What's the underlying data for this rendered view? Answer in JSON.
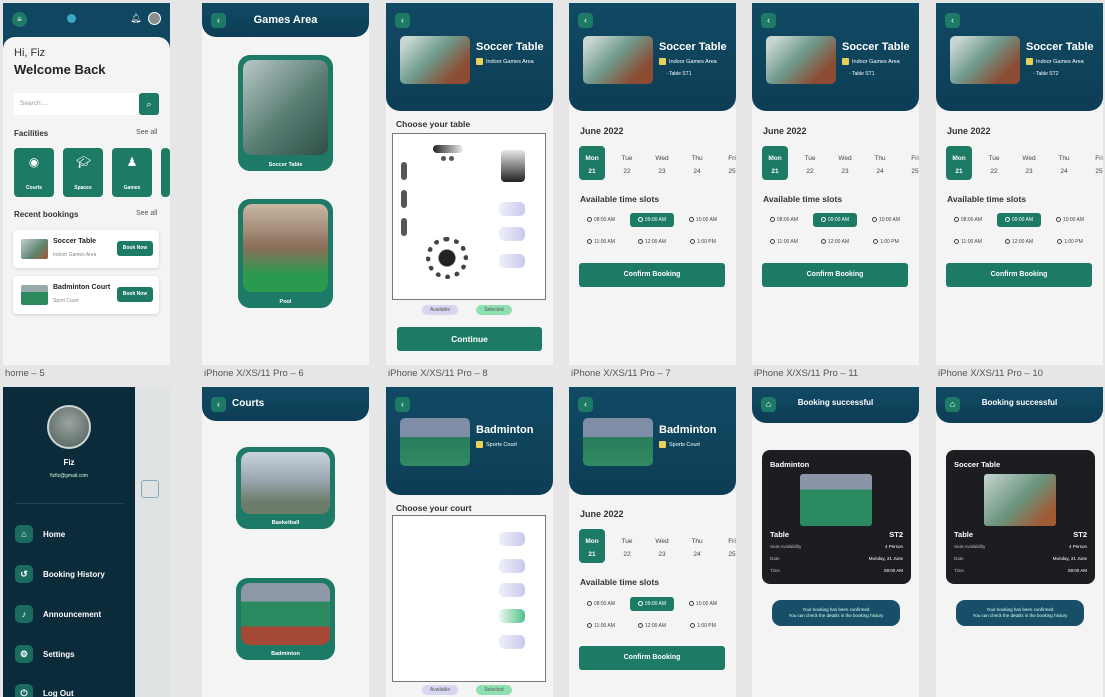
{
  "labels": {
    "home": "home – 5",
    "games": "iPhone X/XS/11 Pro – 6",
    "choose_table": "iPhone X/XS/11 Pro – 8",
    "date_7": "iPhone X/XS/11 Pro – 7",
    "date_11": "iPhone X/XS/11 Pro – 11",
    "date_10": "iPhone X/XS/11 Pro – 10"
  },
  "home": {
    "greeting": "Hi, Fiz",
    "welcome": "Welcome Back",
    "search_placeholder": "Search....",
    "facilities_title": "Facilities",
    "see_all": "See all",
    "facilities": [
      "Courts",
      "Spaces",
      "Games"
    ],
    "recent_title": "Recent bookings",
    "recent": [
      {
        "name": "Soccer Table",
        "sub": "Indoor Games Area",
        "btn": "Book Now"
      },
      {
        "name": "Badminton Court",
        "sub": "Sport Court",
        "btn": "Book Now"
      }
    ]
  },
  "games": {
    "title": "Games Area",
    "items": [
      "Soccer Table",
      "Pool"
    ]
  },
  "courts": {
    "title": "Courts",
    "items": [
      "Basketball",
      "Badminton"
    ]
  },
  "soccer": {
    "title": "Soccer Table",
    "area": "Indoor Games Area",
    "table7": "- Table ST1",
    "table11": "- Table ST1",
    "table10": "- Table ST2"
  },
  "badminton": {
    "title": "Badminton",
    "area": "Sports Court"
  },
  "choose_table": "Choose your table",
  "choose_court": "Choose your court",
  "legend": {
    "available": "Available",
    "selected": "Selected"
  },
  "continue_label": "Continue",
  "month": "June 2022",
  "days": [
    {
      "d": "Mon",
      "n": "21"
    },
    {
      "d": "Tue",
      "n": "22"
    },
    {
      "d": "Wed",
      "n": "23"
    },
    {
      "d": "Thu",
      "n": "24"
    },
    {
      "d": "Fri",
      "n": "25"
    }
  ],
  "slots_title": "Available time slots",
  "slots_row1": [
    "08:00 AM",
    "09:00 AM",
    "10:00 AM"
  ],
  "slots_row2": [
    "11:00 AM",
    "12:00 AM",
    "1:00 PM"
  ],
  "confirm_label": "Confirm Booking",
  "drawer": {
    "name": "Fiz",
    "email": "fizfiz@gmail.com",
    "items": [
      "Home",
      "Booking History",
      "Announcement",
      "Settings",
      "Log Out"
    ]
  },
  "success": {
    "title": "Booking successful",
    "left": {
      "name": "Badminton",
      "table_label": "Table",
      "table_val": "ST2"
    },
    "right": {
      "name": "Soccer Table",
      "table_label": "Table",
      "table_val": "ST2"
    },
    "rows": [
      {
        "k": "Seat Availability",
        "v": "4 Person"
      },
      {
        "k": "Date",
        "v": "Monday, 21 June"
      },
      {
        "k": "Time",
        "v": "09:00 AM"
      }
    ],
    "note1": "Your booking has been confirmed",
    "note2": "You can check the details in the booking history"
  },
  "colors": {
    "primary": "#1d7a64",
    "header": "#0f4660",
    "drawer": "#0b2a3a"
  }
}
